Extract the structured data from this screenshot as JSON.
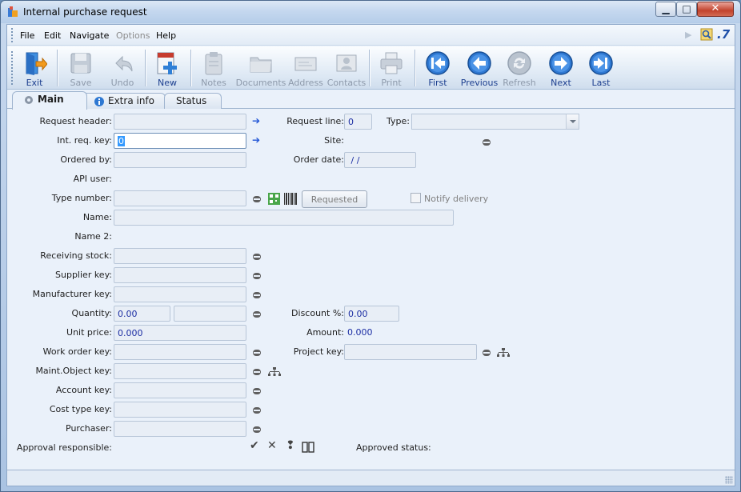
{
  "window": {
    "title": "Internal purchase request"
  },
  "menu": {
    "items": [
      "File",
      "Edit",
      "Navigate",
      "Options",
      "Help"
    ]
  },
  "toolbar": {
    "buttons": [
      {
        "label": "Exit",
        "enabled": true
      },
      {
        "label": "Save",
        "enabled": false
      },
      {
        "label": "Undo",
        "enabled": false
      },
      {
        "label": "New",
        "enabled": true
      },
      {
        "label": "Notes",
        "enabled": false
      },
      {
        "label": "Documents",
        "enabled": false
      },
      {
        "label": "Address",
        "enabled": false
      },
      {
        "label": "Contacts",
        "enabled": false
      },
      {
        "label": "Print",
        "enabled": false
      },
      {
        "label": "First",
        "enabled": true
      },
      {
        "label": "Previous",
        "enabled": true
      },
      {
        "label": "Refresh",
        "enabled": false
      },
      {
        "label": "Next",
        "enabled": true
      },
      {
        "label": "Last",
        "enabled": true
      }
    ]
  },
  "tabs": [
    {
      "label": "Main",
      "active": true
    },
    {
      "label": "Extra info",
      "active": false
    },
    {
      "label": "Status",
      "active": false
    }
  ],
  "form": {
    "request_header": {
      "label": "Request header:",
      "value": ""
    },
    "request_line": {
      "label": "Request line:",
      "value": "0"
    },
    "type": {
      "label": "Type:",
      "value": ""
    },
    "int_req_key": {
      "label": "Int. req. key:",
      "value": "0"
    },
    "site": {
      "label": "Site:",
      "value": ""
    },
    "ordered_by": {
      "label": "Ordered by:",
      "value": ""
    },
    "order_date": {
      "label": "Order date:",
      "value": " / /"
    },
    "api_user": {
      "label": "API user:",
      "value": ""
    },
    "type_number": {
      "label": "Type number:",
      "value": ""
    },
    "requested_button": "Requested",
    "notify_delivery": "Notify delivery",
    "name": {
      "label": "Name:",
      "value": ""
    },
    "name2": {
      "label": "Name 2:",
      "value": ""
    },
    "receiving_stock": {
      "label": "Receiving stock:",
      "value": ""
    },
    "supplier_key": {
      "label": "Supplier key:",
      "value": ""
    },
    "manufacturer_key": {
      "label": "Manufacturer key:",
      "value": ""
    },
    "quantity": {
      "label": "Quantity:",
      "value": "0.00",
      "unit": ""
    },
    "discount": {
      "label": "Discount %:",
      "value": "0.00"
    },
    "unit_price": {
      "label": "Unit price:",
      "value": "0.000"
    },
    "amount": {
      "label": "Amount:",
      "value": "0.000"
    },
    "work_order_key": {
      "label": "Work order key:",
      "value": ""
    },
    "project_key": {
      "label": "Project key:",
      "value": ""
    },
    "maint_object_key": {
      "label": "Maint.Object key:",
      "value": ""
    },
    "account_key": {
      "label": "Account key:",
      "value": ""
    },
    "cost_type_key": {
      "label": "Cost type key:",
      "value": ""
    },
    "purchaser": {
      "label": "Purchaser:",
      "value": ""
    },
    "approval_responsible": {
      "label": "Approval responsible:"
    },
    "approved_status": {
      "label": "Approved status:"
    }
  }
}
